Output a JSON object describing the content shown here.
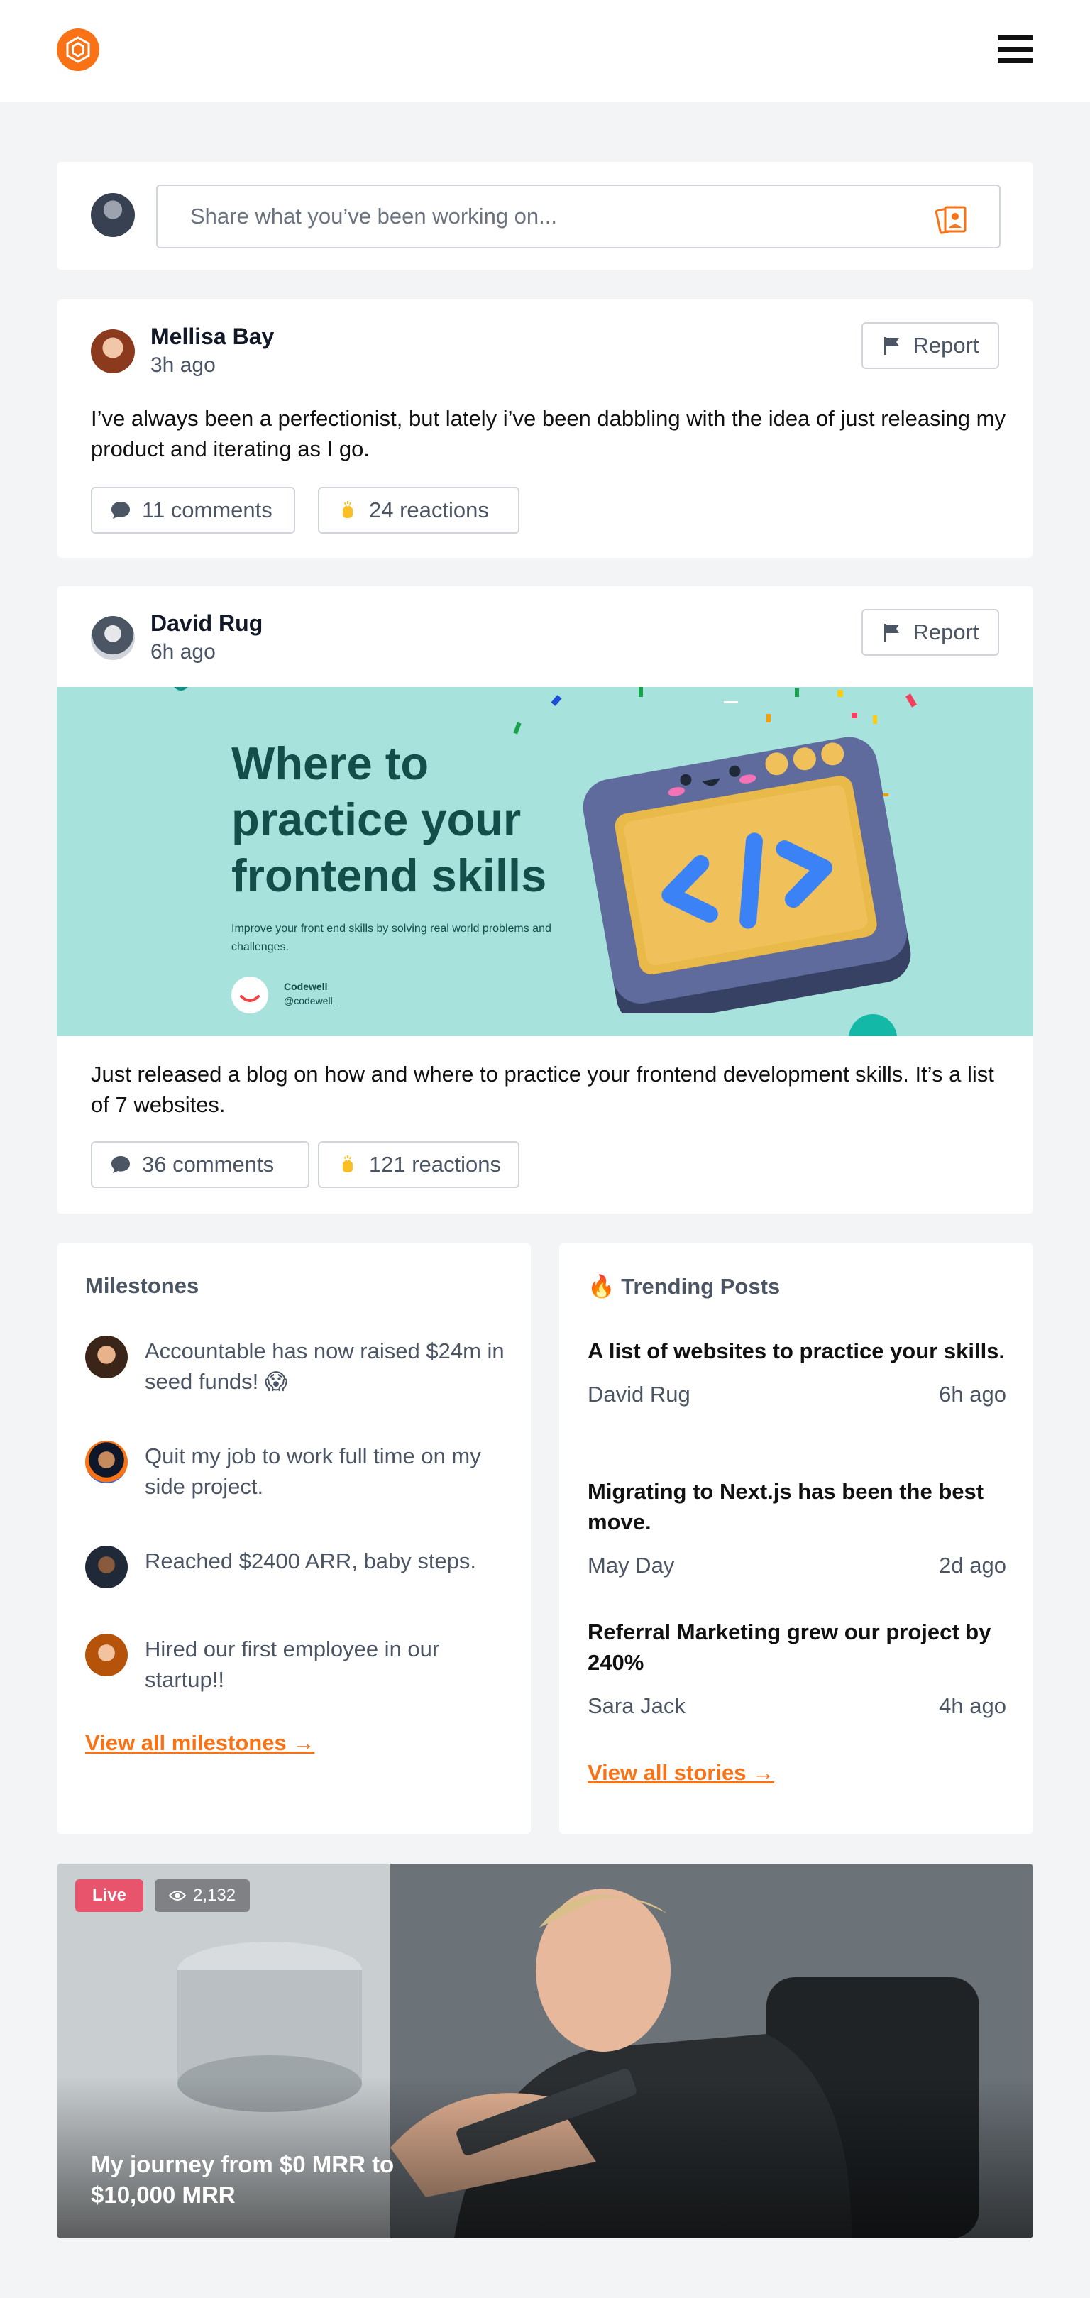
{
  "header": {
    "logo": "hexagon-logo-icon",
    "menu": "hamburger-menu-icon",
    "accent": "#f97316"
  },
  "composer": {
    "placeholder": "Share what you’ve been working on...",
    "icon": "photo-upload-icon"
  },
  "posts": [
    {
      "author": "Mellisa Bay",
      "time": "3h ago",
      "report_label": "Report",
      "text": "I’ve always been a perfectionist, but lately i’ve been dabbling with the idea of just releasing my product and iterating as I go.",
      "comments": "11 comments",
      "reactions": "24 reactions"
    },
    {
      "author": "David Rug",
      "time": "6h ago",
      "report_label": "Report",
      "banner": {
        "title_line1": "Where to",
        "title_line2": "practice your",
        "title_line3": "frontend skills",
        "subtitle": "Improve your front end skills by solving real world problems and challenges.",
        "brand": "Codewell",
        "handle": "@codewell_"
      },
      "text": "Just released a blog on how and where to practice your frontend development skills. It’s a list of 7 websites.",
      "comments": "36 comments",
      "reactions": "121 reactions"
    }
  ],
  "milestones": {
    "title": "Milestones",
    "items": [
      {
        "text": "Accountable has now raised $24m in seed funds! 😱"
      },
      {
        "text": "Quit my job to work full time on my side project."
      },
      {
        "text": "Reached $2400 ARR, baby steps."
      },
      {
        "text": "Hired our first employee in our startup!!"
      }
    ],
    "link": "View all milestones →"
  },
  "trending": {
    "title": "🔥 Trending Posts",
    "items": [
      {
        "title": "A list of websites to practice your skills.",
        "author": "David Rug",
        "time": "6h ago"
      },
      {
        "title": "Migrating to Next.js has been the best move.",
        "author": "May Day",
        "time": "2d ago"
      },
      {
        "title": "Referral Marketing grew our project by 240%",
        "author": "Sara Jack",
        "time": "4h ago"
      }
    ],
    "link": "View all stories →"
  },
  "live": {
    "badge": "Live",
    "views": "2,132",
    "title": "My journey from $0 MRR to $10,000 MRR",
    "live_color": "#e8546b"
  }
}
